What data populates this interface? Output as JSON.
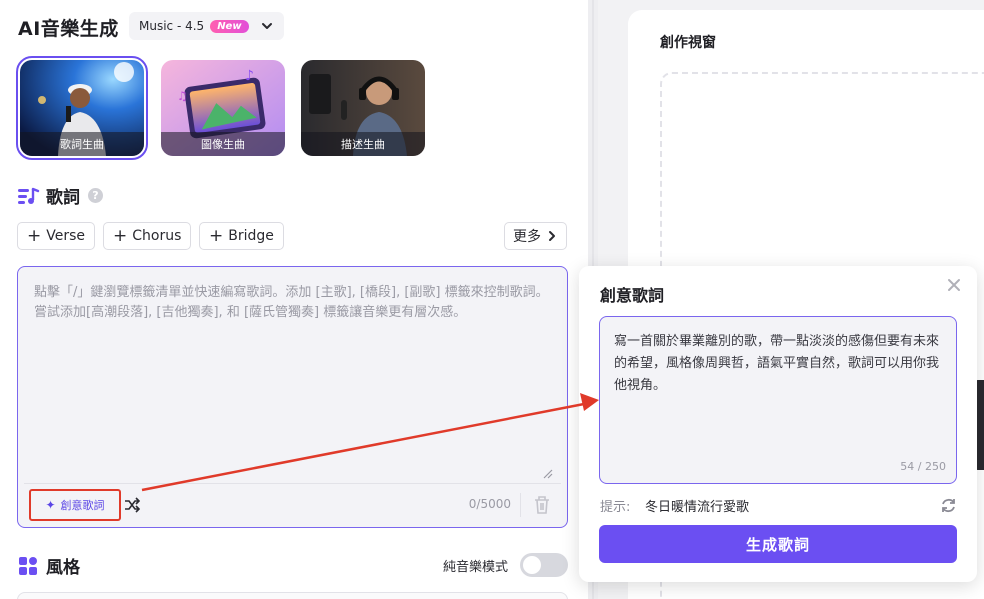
{
  "header": {
    "title": "AI音樂生成",
    "model_label": "Music - 4.5",
    "model_badge": "New"
  },
  "modes": [
    {
      "label": "歌詞生曲",
      "active": true
    },
    {
      "label": "圖像生曲",
      "active": false
    },
    {
      "label": "描述生曲",
      "active": false
    }
  ],
  "lyrics": {
    "section_title": "歌詞",
    "chips": [
      "Verse",
      "Chorus",
      "Bridge"
    ],
    "more_label": "更多",
    "placeholder": "點擊「/」鍵瀏覽標籤清單並快速編寫歌詞。添加 [主歌], [橋段], [副歌] 標籤來控制歌詞。嘗試添加[高潮段落], [吉他獨奏], 和 [薩氏管獨奏] 標籤讓音樂更有層次感。",
    "creative_label": "創意歌詞",
    "counter": "0/5000"
  },
  "style": {
    "section_title": "風格",
    "toggle_label": "純音樂模式"
  },
  "canvas": {
    "title": "創作視窗"
  },
  "popup": {
    "title": "創意歌詞",
    "prompt": "寫一首關於畢業離別的歌，帶一點淡淡的感傷但要有未來的希望，風格像周興哲，語氣平實自然，歌詞可以用你我他視角。",
    "count": "54 / 250",
    "hint_label": "提示:",
    "hint_value": "冬日暖情流行愛歌",
    "generate_label": "生成歌詞"
  },
  "colors": {
    "accent": "#6b4ff2",
    "annotation": "#e03a2a"
  }
}
